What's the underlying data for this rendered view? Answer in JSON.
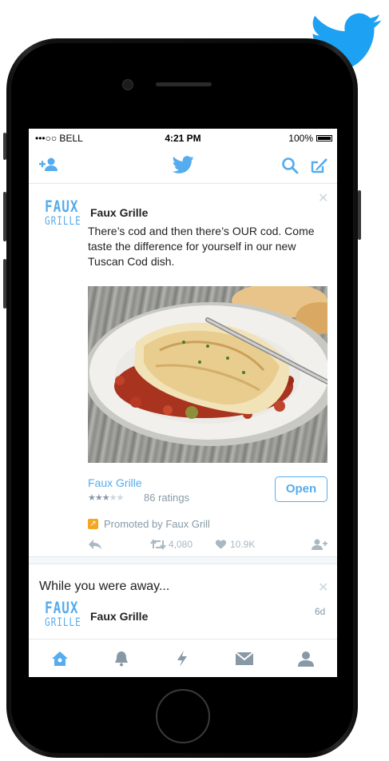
{
  "status_bar": {
    "carrier": "•••○○ BELL",
    "time": "4:21 PM",
    "battery": "100%"
  },
  "nav": {
    "icons": [
      "add-user-icon",
      "twitter-bird-icon",
      "search-icon",
      "compose-icon"
    ]
  },
  "promoted_tweet": {
    "logo_line1": "FAUX",
    "logo_line2": "GRILLE",
    "author": "Faux Grille",
    "text": "There’s cod and then there’s OUR cod. Come taste the difference for yourself in our new Tuscan Cod dish.",
    "media_description": "Grilled cod fillet on tomato ragout",
    "app_card": {
      "name": "Faux Grille",
      "rating": 2.5,
      "rating_max": 5,
      "ratings_count": "86 ratings",
      "button_label": "Open"
    },
    "promoted_by": "Promoted by Faux Grill",
    "actions": {
      "retweets": "4,080",
      "likes": "10.9K"
    }
  },
  "while_away": {
    "title": "While you were away...",
    "logo_line1": "FAUX",
    "logo_line2": "GRILLE",
    "author": "Faux Grille",
    "time": "6d"
  },
  "tabbar": {
    "tabs": [
      "home-icon",
      "notifications-icon",
      "moments-icon",
      "messages-icon",
      "profile-icon"
    ],
    "active": "home-icon"
  },
  "colors": {
    "twitter_blue": "#55acee",
    "gray_text": "#8899a6",
    "promo_orange": "#f5a623"
  }
}
